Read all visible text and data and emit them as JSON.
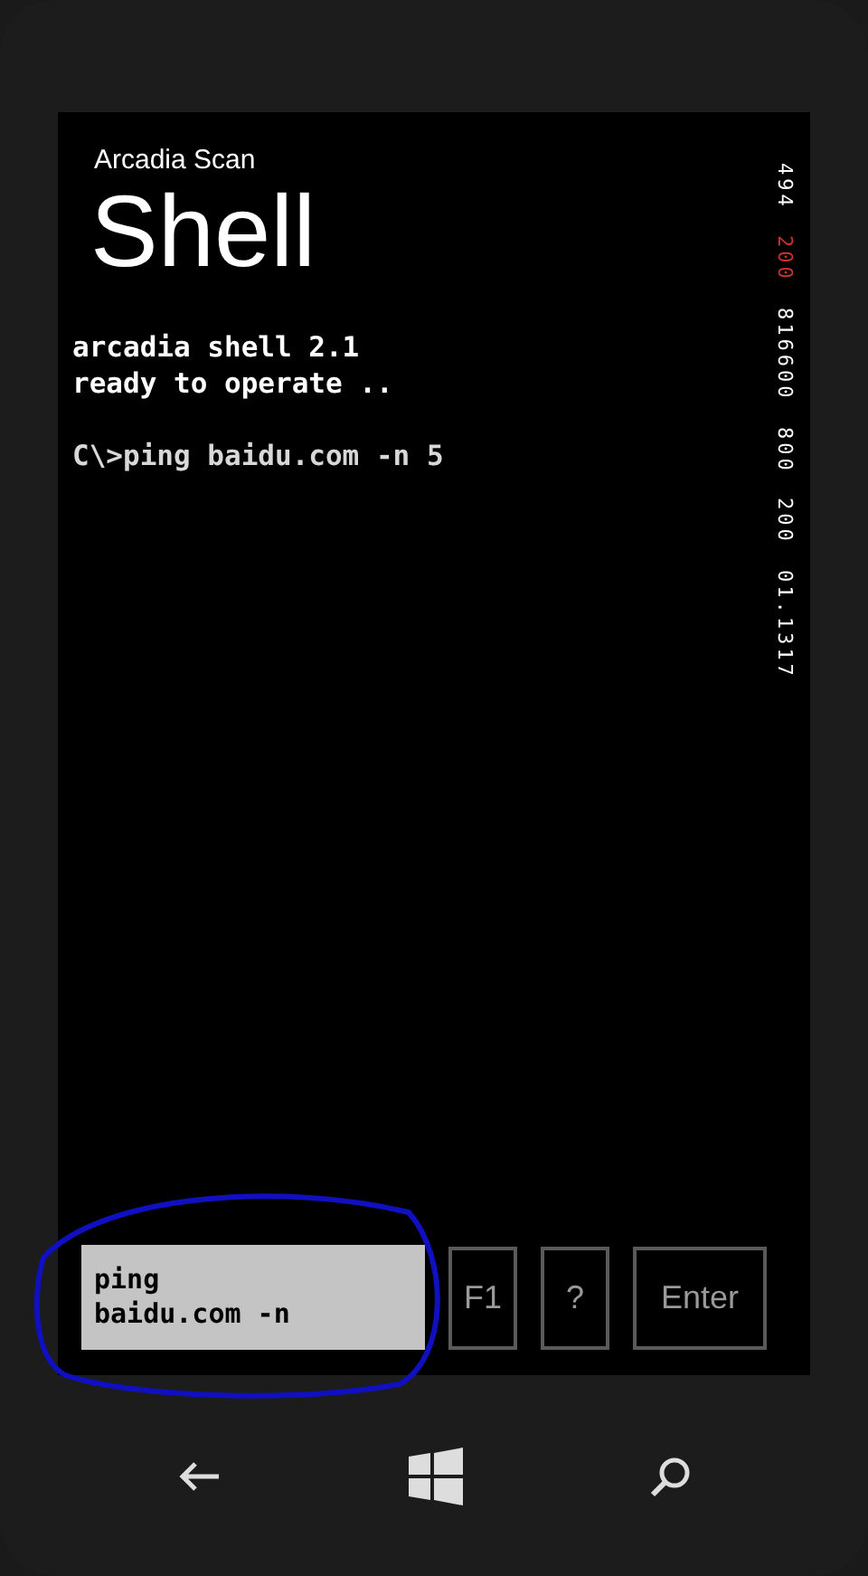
{
  "app": {
    "name": "Arcadia Scan",
    "page_title": "Shell"
  },
  "console": {
    "lines": [
      {
        "text": "arcadia shell 2.1",
        "kind": "output"
      },
      {
        "text": "ready to operate ..",
        "kind": "output"
      },
      {
        "kind": "blank"
      },
      {
        "text": "C\\>ping baidu.com -n 5",
        "kind": "command"
      }
    ]
  },
  "side_readout": [
    {
      "text": "494",
      "color": "#ffffff"
    },
    {
      "text": "200",
      "color": "#d03030"
    },
    {
      "text": "816600",
      "color": "#ffffff"
    },
    {
      "text": "800",
      "color": "#ffffff"
    },
    {
      "text": "200",
      "color": "#ffffff"
    },
    {
      "text": "01.1317",
      "color": "#ffffff"
    }
  ],
  "command_input": {
    "value": "ping\nbaidu.com -n"
  },
  "buttons": [
    {
      "label": "F1",
      "kind": "small"
    },
    {
      "label": "?",
      "kind": "small"
    },
    {
      "label": "Enter",
      "kind": "wide"
    }
  ],
  "annotation": {
    "kind": "circle",
    "color": "#1010c0"
  }
}
